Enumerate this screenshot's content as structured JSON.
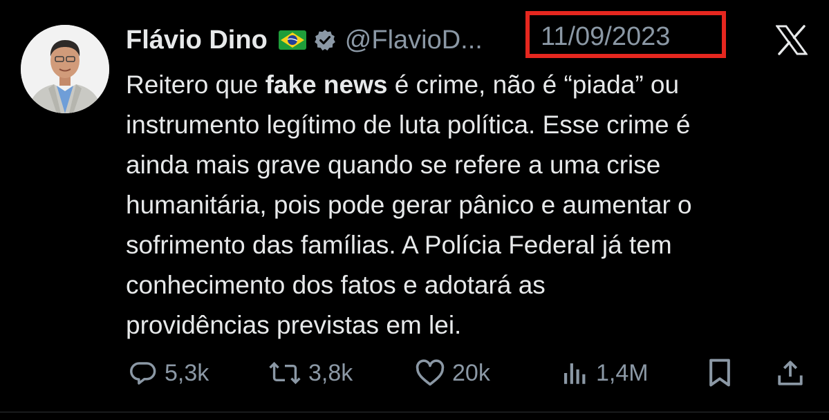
{
  "tweet": {
    "author_name": "Flávio Dino",
    "handle": "@FlavioD...",
    "date": "11/09/2023",
    "body": {
      "line1_a": "Reitero que ",
      "line1_bold": "fake news",
      "line1_b": " é crime, não é “piada” ou",
      "line2": "instrumento legítimo de luta política. Esse crime é",
      "line3": "ainda mais grave quando se refere a uma crise",
      "line4": "humanitária, pois pode gerar pânico e aumentar o",
      "line5": "sofrimento das famílias. A Polícia Federal já tem",
      "line6": "conhecimento dos fatos e adotará as",
      "line7": "providências previstas em lei."
    }
  },
  "actions": {
    "replies": "5,3k",
    "retweets": "3,8k",
    "likes": "20k",
    "views": "1,4M"
  },
  "icons": {
    "flag": "brazil-flag-icon",
    "verified": "verified-badge-icon",
    "close": "x-logo-icon",
    "reply": "reply-icon",
    "retweet": "retweet-icon",
    "like": "heart-icon",
    "views": "views-icon",
    "bookmark": "bookmark-icon",
    "share": "share-icon"
  },
  "colors": {
    "background": "#000000",
    "text": "#e7e9ea",
    "muted": "#8b98a5",
    "highlight_box": "#e5271f"
  }
}
